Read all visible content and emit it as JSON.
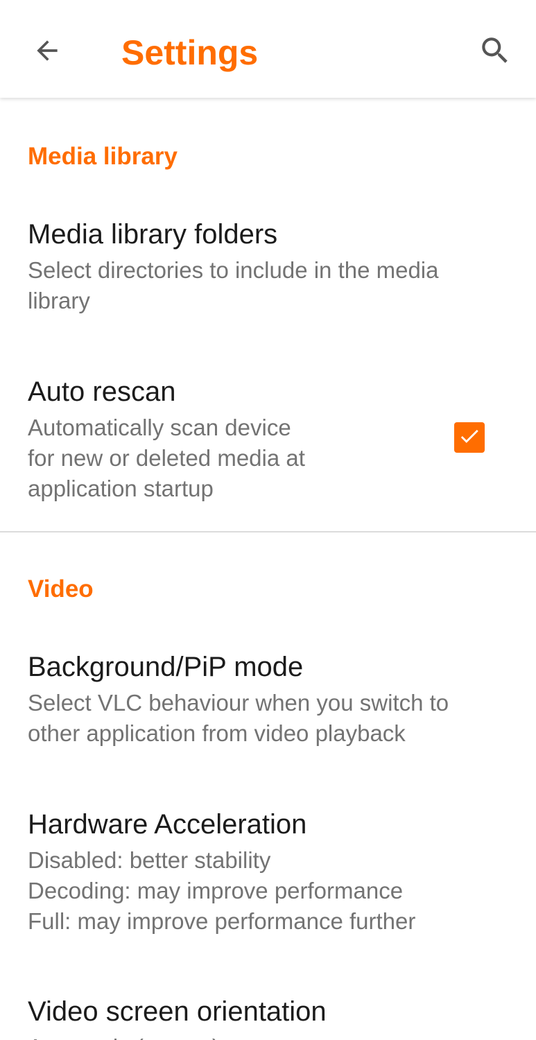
{
  "app": {
    "title": "Settings",
    "accent_color": "#ff6d00",
    "back_icon": "arrow-back-icon",
    "search_icon": "search-icon"
  },
  "sections": [
    {
      "header": "Media library",
      "items": [
        {
          "title": "Media library folders",
          "summary": "Select directories to include in the media\nlibrary"
        },
        {
          "title": "Auto rescan",
          "summary": "Automatically scan device\nfor new or deleted media at\napplication startup",
          "checkbox_checked": true
        }
      ]
    },
    {
      "header": "Video",
      "items": [
        {
          "title": "Background/PiP mode",
          "summary": "Select VLC behaviour when you switch to\nother application from video playback"
        },
        {
          "title": "Hardware Acceleration",
          "summary": "Disabled: better stability\nDecoding: may improve performance\nFull: may improve performance further"
        },
        {
          "title": "Video screen orientation",
          "summary": "Automatic (sensor)"
        }
      ]
    }
  ]
}
